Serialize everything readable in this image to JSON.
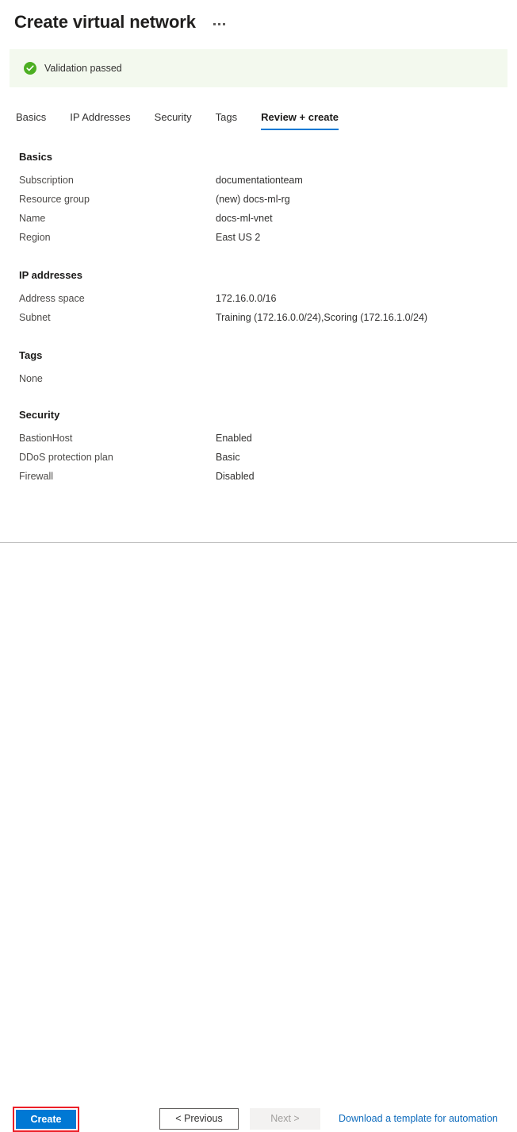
{
  "header": {
    "title": "Create virtual network",
    "more_actions_icon": "ellipsis-horizontal-icon"
  },
  "validation": {
    "icon": "check-circle-icon",
    "message": "Validation passed",
    "background_color": "#f3f9ee",
    "icon_color": "#4caf22"
  },
  "tabs": [
    {
      "label": "Basics",
      "active": false
    },
    {
      "label": "IP Addresses",
      "active": false
    },
    {
      "label": "Security",
      "active": false
    },
    {
      "label": "Tags",
      "active": false
    },
    {
      "label": "Review + create",
      "active": true
    }
  ],
  "active_tab_underline_color": "#0078d4",
  "sections": {
    "basics": {
      "title": "Basics",
      "rows": [
        {
          "key": "Subscription",
          "value": "documentationteam"
        },
        {
          "key": "Resource group",
          "value": "(new) docs-ml-rg"
        },
        {
          "key": "Name",
          "value": "docs-ml-vnet"
        },
        {
          "key": "Region",
          "value": "East US 2"
        }
      ]
    },
    "ip_addresses": {
      "title": "IP addresses",
      "rows": [
        {
          "key": "Address space",
          "value": "172.16.0.0/16"
        },
        {
          "key": "Subnet",
          "value": "Training (172.16.0.0/24),Scoring (172.16.1.0/24)"
        }
      ]
    },
    "tags": {
      "title": "Tags",
      "empty_value": "None"
    },
    "security": {
      "title": "Security",
      "rows": [
        {
          "key": "BastionHost",
          "value": "Enabled"
        },
        {
          "key": "DDoS protection plan",
          "value": "Basic"
        },
        {
          "key": "Firewall",
          "value": "Disabled"
        }
      ]
    }
  },
  "footer": {
    "create_label": "Create",
    "create_color": "#0078d4",
    "highlight_color": "#ec2028",
    "previous_label": "< Previous",
    "next_label": "Next >",
    "next_disabled": true,
    "download_link_label": "Download a template for automation",
    "link_color": "#0f6cbd"
  }
}
